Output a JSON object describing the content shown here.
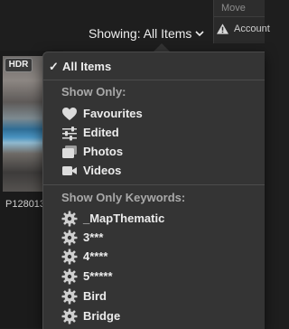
{
  "right_panel": {
    "move_label": "Move",
    "account_label": "Account"
  },
  "filter": {
    "label": "Showing: All Items"
  },
  "thumbnail": {
    "badge": "HDR",
    "filename": "P128013"
  },
  "menu": {
    "all_items": "All Items",
    "show_only_header": "Show Only:",
    "show_only": [
      {
        "label": "Favourites",
        "icon": "heart-icon"
      },
      {
        "label": "Edited",
        "icon": "sliders-icon"
      },
      {
        "label": "Photos",
        "icon": "photos-icon"
      },
      {
        "label": "Videos",
        "icon": "video-camera-icon"
      }
    ],
    "keywords_header": "Show Only Keywords:",
    "keywords": [
      {
        "label": "_MapThematic",
        "icon": "gear-icon"
      },
      {
        "label": "3***",
        "icon": "gear-icon"
      },
      {
        "label": "4****",
        "icon": "gear-icon"
      },
      {
        "label": "5*****",
        "icon": "gear-icon"
      },
      {
        "label": "Bird",
        "icon": "gear-icon"
      },
      {
        "label": "Bridge",
        "icon": "gear-icon"
      }
    ]
  },
  "colors": {
    "menu_bg": "#343434",
    "text": "#ececec",
    "section_header": "#a9a9a9"
  }
}
